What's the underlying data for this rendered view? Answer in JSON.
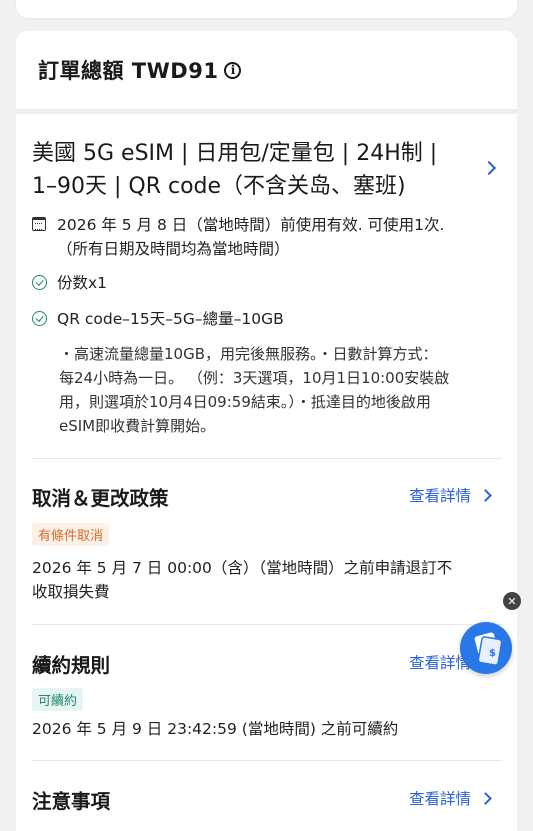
{
  "order": {
    "total_label": "訂單總額 TWD91",
    "info_icon": "info-icon"
  },
  "product": {
    "title_line1": "美國 5G eSIM | 日用包/定量包 | 24H制 |",
    "title_line2": "1–90天 | QR code（不含关岛、塞班)",
    "validity_line1": "2026 年 5 月 8 日（當地時間）前使用有效. 可使用1次.",
    "validity_line2": "（所有日期及時間均為當地時間）",
    "quantity": "份数x1",
    "package": "QR code–15天–5G–總量–10GB",
    "note_lines": [
      "・高速流量總量10GB，用完後無服務。・日數計算方式：",
      "每24小時為一日。 （例：3天選項，10月1日10:00安裝啟",
      "用，則選項於10月4日09:59結束。）・抵達目的地後啟用",
      "eSIM即收費計算開始。"
    ]
  },
  "cancel_policy": {
    "title": "取消＆更改政策",
    "link": "查看詳情",
    "tag": "有條件取消",
    "text_line1": "2026 年 5 月 7 日 00:00（含）（當地時間）之前申請退訂不",
    "text_line2": "收取損失費"
  },
  "renewal": {
    "title": "續約規則",
    "link": "查看詳情",
    "tag": "可續約",
    "text": "2026 年 5 月 9 日 23:42:59 (當地時間) 之前可續約"
  },
  "notes": {
    "title": "注意事項",
    "link": "查看詳情"
  },
  "colors": {
    "accent": "#2b62d9",
    "green": "#1f8a70",
    "orange": "#d9692f",
    "float_button": "#2a78e8"
  }
}
